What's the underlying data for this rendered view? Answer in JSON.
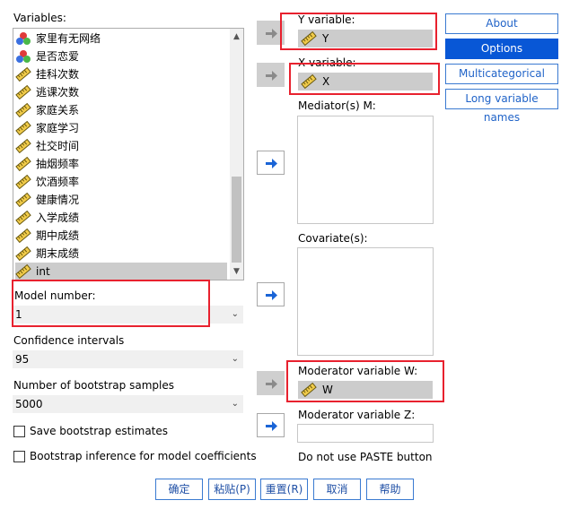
{
  "variables_label": "Variables:",
  "variables": [
    {
      "name": "家里有无网络",
      "icon": "nominal-icon"
    },
    {
      "name": "是否恋爱",
      "icon": "nominal-icon"
    },
    {
      "name": "挂科次数",
      "icon": "scale-icon"
    },
    {
      "name": "逃课次数",
      "icon": "scale-icon"
    },
    {
      "name": "家庭关系",
      "icon": "scale-icon"
    },
    {
      "name": "家庭学习",
      "icon": "scale-icon"
    },
    {
      "name": "社交时间",
      "icon": "scale-icon"
    },
    {
      "name": "抽烟频率",
      "icon": "scale-icon"
    },
    {
      "name": "饮酒频率",
      "icon": "scale-icon"
    },
    {
      "name": "健康情况",
      "icon": "scale-icon"
    },
    {
      "name": "入学成绩",
      "icon": "scale-icon"
    },
    {
      "name": "期中成绩",
      "icon": "scale-icon"
    },
    {
      "name": "期末成绩",
      "icon": "scale-icon"
    },
    {
      "name": "int",
      "icon": "scale-icon",
      "selected": true
    }
  ],
  "model_number": {
    "label": "Model number:",
    "value": "1"
  },
  "confidence": {
    "label": "Confidence intervals",
    "value": "95"
  },
  "bootstrap": {
    "label": "Number of bootstrap samples",
    "value": "5000"
  },
  "checkboxes": {
    "save_bootstrap": "Save bootstrap estimates",
    "bootstrap_inference": "Bootstrap inference for model coefficients"
  },
  "y_variable": {
    "label": "Y variable:",
    "value": "Y"
  },
  "x_variable": {
    "label": "X variable:",
    "value": "X"
  },
  "mediators_label": "Mediator(s) M:",
  "covariates_label": "Covariate(s):",
  "moderator_w": {
    "label": "Moderator variable W:",
    "value": "W"
  },
  "moderator_z": {
    "label": "Moderator variable Z:",
    "value": ""
  },
  "paste_note": "Do not use PASTE button",
  "side_buttons": {
    "about": "About",
    "options": "Options",
    "multicategorical": "Multicategorical",
    "long_names": "Long variable names"
  },
  "bottom_buttons": {
    "ok": "确定",
    "paste": "粘贴(P)",
    "reset": "重置(R)",
    "cancel": "取消",
    "help": "帮助"
  },
  "colors": {
    "highlight_box": "#e8212e",
    "active_button": "#0857d6",
    "arrow_blue": "#1a64d6"
  }
}
